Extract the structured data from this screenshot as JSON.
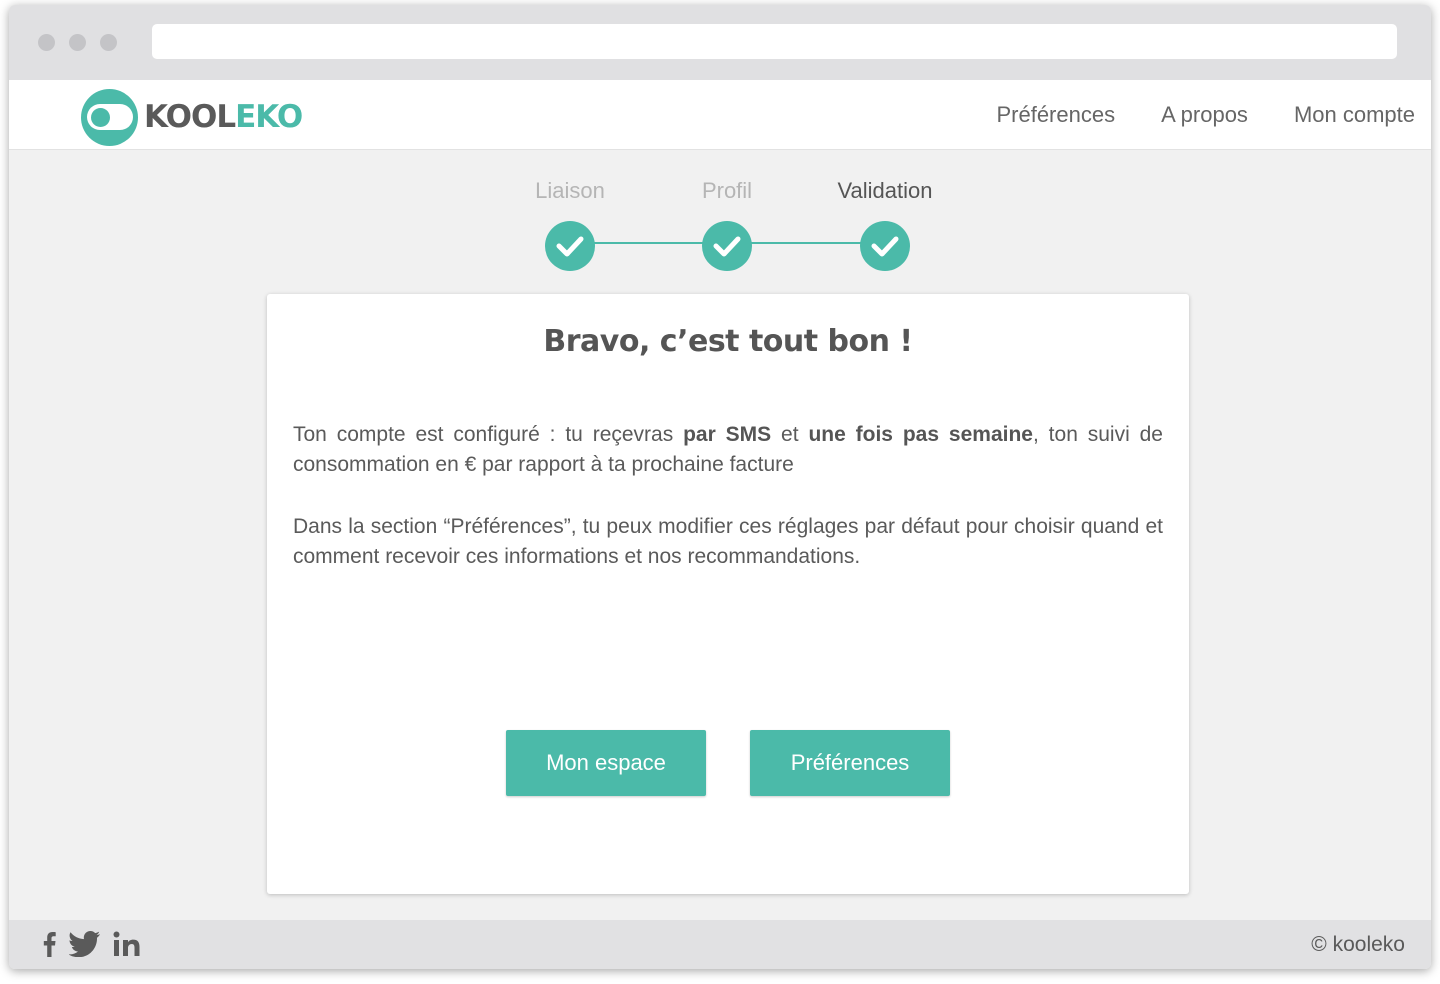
{
  "brand": {
    "name_part1": "KOOL",
    "name_part2": "EKO",
    "color": "#4bbaa9"
  },
  "nav": {
    "items": [
      {
        "label": "Préférences"
      },
      {
        "label": "A propos"
      },
      {
        "label": "Mon compte"
      }
    ]
  },
  "stepper": {
    "steps": [
      {
        "label": "Liaison",
        "state": "done",
        "icon": "check-icon"
      },
      {
        "label": "Profil",
        "state": "done",
        "icon": "check-icon"
      },
      {
        "label": "Validation",
        "state": "active",
        "icon": "check-icon"
      }
    ]
  },
  "card": {
    "title": "Bravo, c’est tout bon !",
    "paragraph1": {
      "t1": "Ton compte est configuré : tu reçevras ",
      "b1": "par SMS",
      "t2": " et ",
      "b2": "une fois pas semaine",
      "t3": ", ton suivi de consommation en € par rapport à ta prochaine facture"
    },
    "paragraph2": "Dans la section “Préférences”, tu peux modifier ces réglages par défaut pour choisir quand et comment recevoir ces informations et nos recommandations.",
    "buttons": [
      {
        "label": "Mon espace"
      },
      {
        "label": "Préférences"
      }
    ]
  },
  "footer": {
    "social": [
      "facebook-icon",
      "twitter-icon",
      "linkedin-icon"
    ],
    "copyright": "© kooleko"
  }
}
